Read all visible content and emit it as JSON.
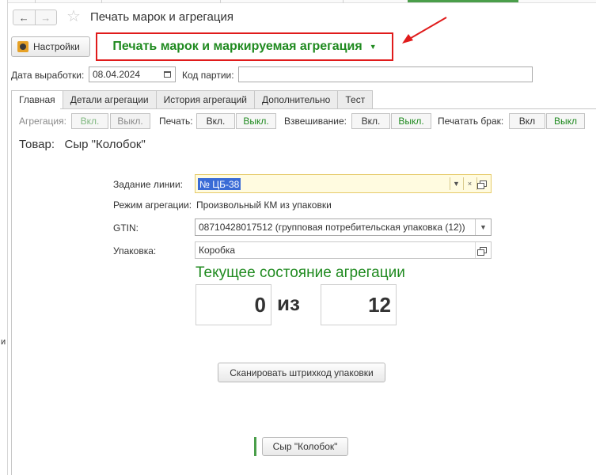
{
  "window": {
    "title": "Печать марок и агрегация"
  },
  "left_fragment": "и",
  "toolbar": {
    "settings_label": "Настройки",
    "main_command": "Печать марок и маркируемая агрегация"
  },
  "header": {
    "date_label": "Дата выработки:",
    "date_value": "08.04.2024",
    "batch_label": "Код партии:",
    "batch_value": ""
  },
  "tabs": [
    {
      "label": "Главная",
      "active": true
    },
    {
      "label": "Детали агрегации"
    },
    {
      "label": "История агрегаций"
    },
    {
      "label": "Дополнительно"
    },
    {
      "label": "Тест"
    }
  ],
  "toggles": {
    "aggregation": {
      "label": "Агрегация:",
      "on": "Вкл.",
      "off": "Выкл."
    },
    "print": {
      "label": "Печать:",
      "on": "Вкл.",
      "off": "Выкл."
    },
    "weighing": {
      "label": "Взвешивание:",
      "on": "Вкл.",
      "off": "Выкл."
    },
    "defect": {
      "label": "Печатать брак:",
      "on": "Вкл",
      "off": "Выкл"
    }
  },
  "product": {
    "label": "Товар:",
    "name": "Сыр \"Колобок\""
  },
  "form": {
    "task_label": "Задание линии:",
    "task_value": "№ ЦБ-38",
    "mode_label": "Режим агрегации:",
    "mode_value": "Произвольный КМ из упаковки",
    "gtin_label": "GTIN:",
    "gtin_value": "08710428017512 (групповая потребительская упаковка (12))",
    "pack_label": "Упаковка:",
    "pack_value": "Коробка"
  },
  "aggregation": {
    "title": "Текущее состояние агрегации",
    "current": "0",
    "of": "из",
    "total": "12"
  },
  "buttons": {
    "scan": "Сканировать штрихкод упаковки",
    "product": "Сыр \"Колобок\""
  },
  "colors": {
    "accent_green": "#1f8a1f",
    "highlight_red": "#e01b1b",
    "selection_blue": "#3a6bd6"
  }
}
